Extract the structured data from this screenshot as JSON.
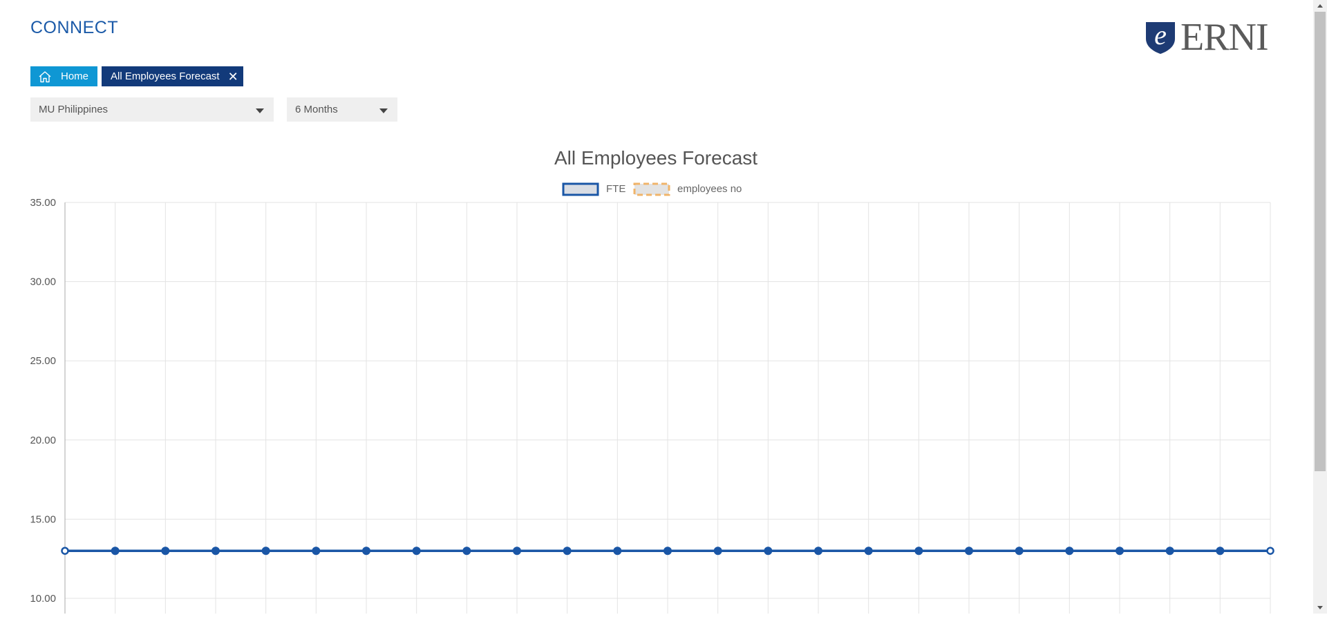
{
  "header": {
    "app_title": "CONNECT",
    "logo_text": "ERNI",
    "logo_letter": "e"
  },
  "tabs": {
    "home_label": "Home",
    "active_label": "All Employees Forecast",
    "close_glyph": "✕"
  },
  "filters": {
    "unit_value": "MU Philippines",
    "period_value": "6 Months"
  },
  "colors": {
    "brand_blue": "#1b5aa8",
    "home_tab": "#0f97d4",
    "active_tab": "#123a7a",
    "fte_line": "#1a56a6",
    "employees_dash": "#f0b46a"
  },
  "icons": {
    "home": "home-icon",
    "close": "close-icon",
    "dropdown": "chevron-down-icon",
    "logo_shield": "shield-icon"
  },
  "chart_data": {
    "type": "line",
    "title": "All Employees Forecast",
    "legend_position": "top-center",
    "grid": true,
    "ylim": [
      10,
      35
    ],
    "yticks": [
      "35.00",
      "30.00",
      "25.00",
      "20.00",
      "15.00",
      "10.00"
    ],
    "x_count": 25,
    "series": [
      {
        "name": "FTE",
        "values": [
          13,
          13,
          13,
          13,
          13,
          13,
          13,
          13,
          13,
          13,
          13,
          13,
          13,
          13,
          13,
          13,
          13,
          13,
          13,
          13,
          13,
          13,
          13,
          13,
          13
        ]
      },
      {
        "name": "employees no",
        "values": []
      }
    ]
  }
}
